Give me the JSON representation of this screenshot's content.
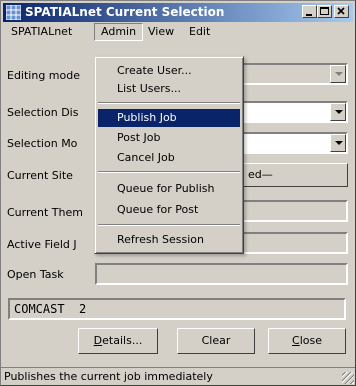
{
  "window": {
    "title": "SPATIALnet Current Selection"
  },
  "menubar": {
    "items": [
      "SPATIALnet",
      "Admin",
      "View",
      "Edit"
    ],
    "open_menu": "Admin"
  },
  "admin_menu": {
    "items": [
      "Create User...",
      "List Users...",
      "Publish Job",
      "Post Job",
      "Cancel Job",
      "Queue for Publish",
      "Queue for Post",
      "Refresh Session"
    ],
    "highlighted": "Publish Job"
  },
  "form": {
    "editing_mode_label": "Editing mode",
    "selection_display_label": "Selection Dis",
    "selection_mode_label": "Selection Mo",
    "current_site_label": "Current Site",
    "current_site_value_fragment": "ed—",
    "current_theme_label": "Current Them",
    "active_field_label": "Active Field J",
    "open_task_label": "Open Task",
    "open_task_value": ""
  },
  "status_box": {
    "text": "COMCAST  2"
  },
  "buttons": {
    "details_prefix": "",
    "details_accel": "D",
    "details_suffix": "etails...",
    "clear": "Clear",
    "close_accel": "C",
    "close_suffix": "lose"
  },
  "statusbar": {
    "text": "Publishes the current job immediately"
  },
  "colors": {
    "title_start": "#0a246a",
    "title_end": "#a6caf0",
    "face": "#d4d0c8",
    "highlight": "#0a246a"
  }
}
